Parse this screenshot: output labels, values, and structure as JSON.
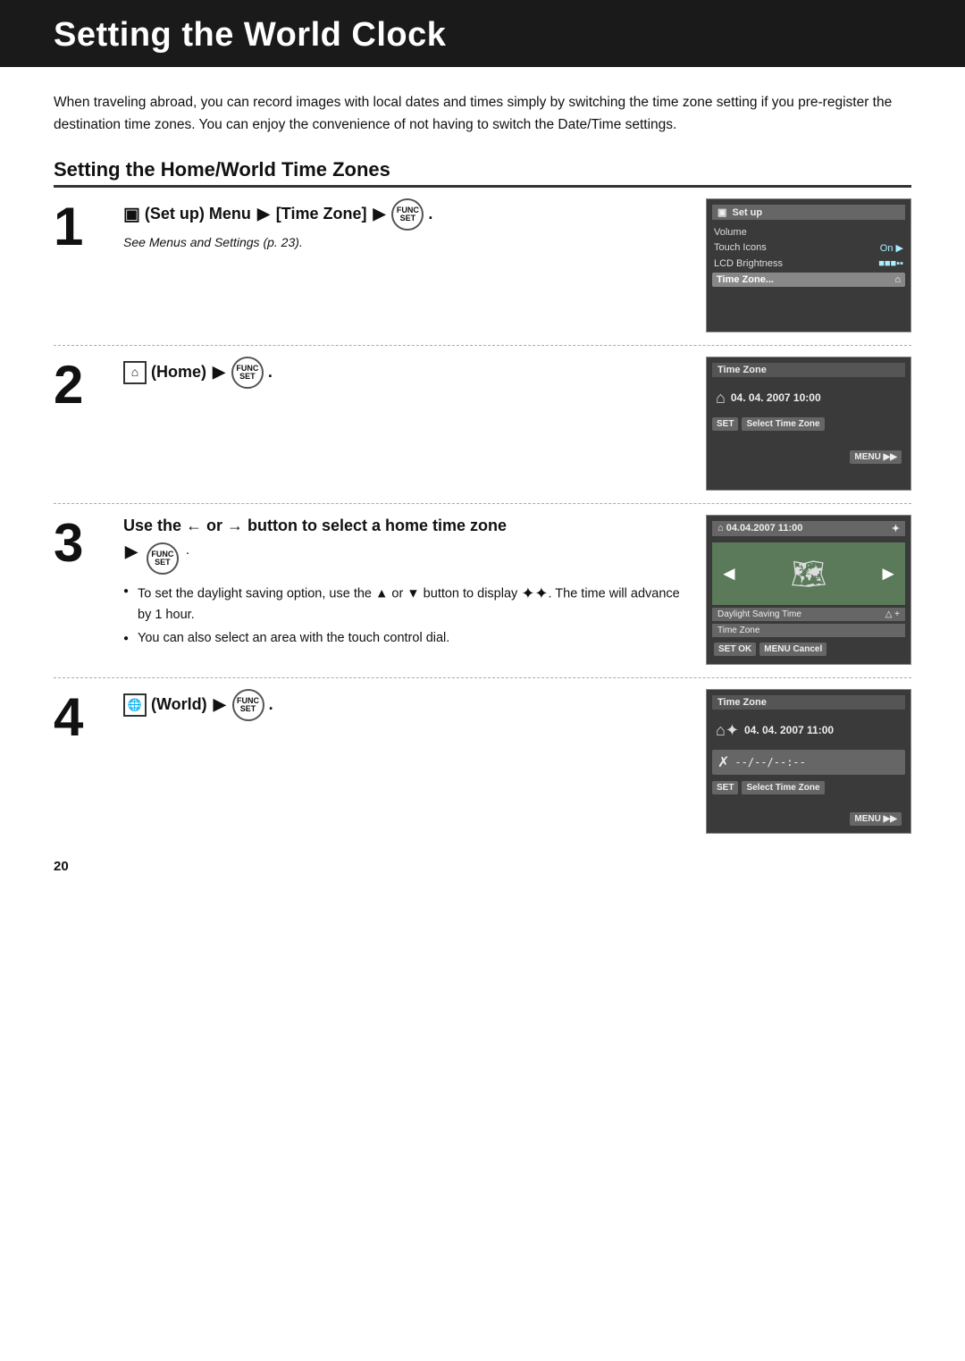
{
  "page": {
    "title": "Setting the World Clock",
    "intro": "When traveling abroad, you can record images with local dates and times simply by switching the time zone setting if you pre-register the destination time zones. You can enjoy the convenience of not having to switch the Date/Time settings.",
    "section_heading": "Setting the Home/World Time Zones",
    "page_number": "20"
  },
  "steps": [
    {
      "number": "1",
      "instruction_parts": [
        "(Set up) Menu",
        "[Time Zone]",
        "FUNC SET"
      ],
      "instruction_text": "(Set up) Menu ▶ [Time Zone] ▶ FUNC/SET.",
      "see_note": "See Menus and Settings (p. 23).",
      "screenshot": {
        "title": "",
        "rows": [
          {
            "label": "Volume",
            "value": ""
          },
          {
            "label": "Touch Icons",
            "value": "On"
          },
          {
            "label": "LCD Brightness",
            "value": "■■■■■"
          },
          {
            "label": "Time Zone...",
            "value": "⌂",
            "highlight": true
          }
        ]
      }
    },
    {
      "number": "2",
      "instruction_text": "(Home) ▶ FUNC/SET.",
      "screenshot": {
        "title": "Time Zone",
        "home_row": "⌂",
        "datetime": "04. 04. 2007 10:00",
        "buttons": [
          "SET Select Time Zone"
        ],
        "menu_btn": "MENU ▶▶"
      }
    },
    {
      "number": "3",
      "instruction_heading": "Use the ← or → button to select a home time zone",
      "func_set": "FUNC SET",
      "bullets": [
        "To set the daylight saving option, use the ▲ or ▼ button to display ✦✦. The time will advance by 1 hour.",
        "You can also select an area with the touch control dial."
      ],
      "screenshot": {
        "title": "04. 04. 2007 11:00 ✦",
        "arrows": {
          "left": "◄",
          "right": "►"
        },
        "map_icon": "🗺",
        "saving_label": "Daylight Saving Time",
        "saving_value": "△ +",
        "zone_label": "Time Zone",
        "buttons": [
          "SET OK",
          "MENU Cancel"
        ]
      }
    },
    {
      "number": "4",
      "instruction_text": "(World) ▶ FUNC/SET.",
      "screenshot": {
        "title": "Time Zone",
        "world_row": "⌂✦",
        "datetime": "04. 04. 2007 11:00",
        "world_label": "✗",
        "world_dashes": "--/--/--:--",
        "buttons": [
          "SET Select Time Zone"
        ],
        "menu_btn": "MENU ▶▶"
      }
    }
  ],
  "icons": {
    "setup_menu": "▣",
    "home": "⌂",
    "world": "🌐",
    "func_set_label": "FUNC\nSET",
    "arrow_right": "▶",
    "arrow_left": "←",
    "arrow_left_unicode": "←",
    "arrow_right_unicode": "→",
    "arrow_up": "▲",
    "arrow_down": "▼",
    "sunstar": "✦✦"
  }
}
